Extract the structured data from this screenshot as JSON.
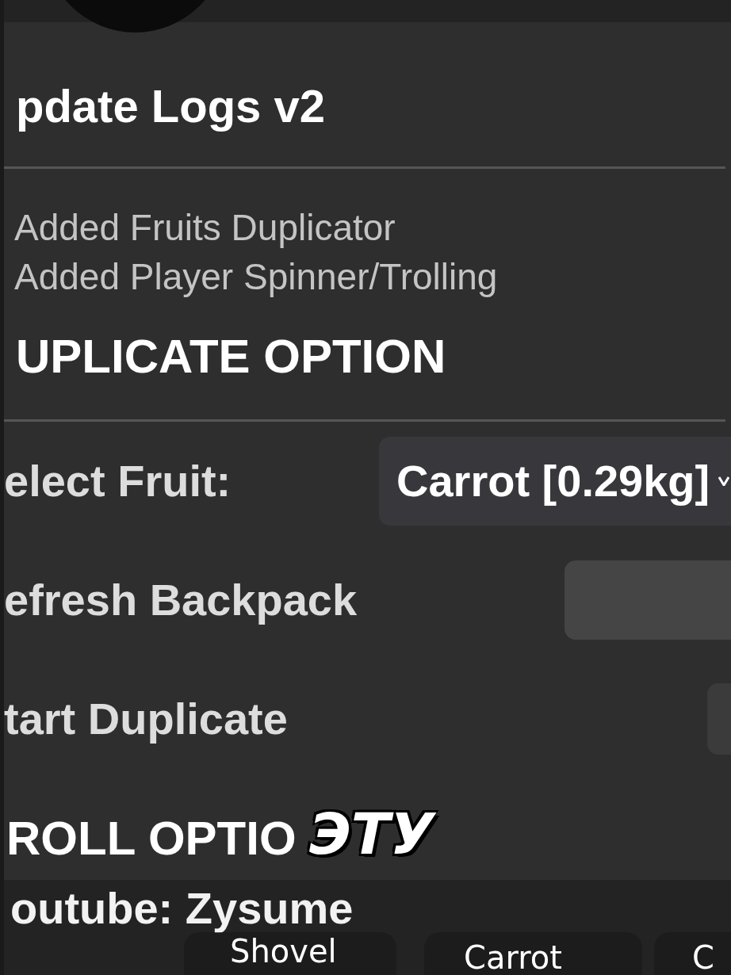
{
  "update_log": {
    "title": "pdate Logs v2",
    "entries": [
      "Added Fruits Duplicator",
      "Added Player Spinner/Trolling"
    ]
  },
  "duplicate_section": {
    "title": "UPLICATE OPTION",
    "controls": [
      {
        "kind": "dropdown",
        "label": "elect Fruit:",
        "value": "Carrot [0.29kg]"
      },
      {
        "kind": "button",
        "label": "efresh Backpack"
      },
      {
        "kind": "toggle",
        "label": "tart Duplicate"
      }
    ]
  },
  "troll_section": {
    "title": "ROLL OPTIO"
  },
  "credit": "outube: Zysume",
  "hotbar": [
    {
      "label": "Shovel"
    },
    {
      "label": "Carrot"
    },
    {
      "label": "C"
    }
  ],
  "caption": "ЭТУ"
}
